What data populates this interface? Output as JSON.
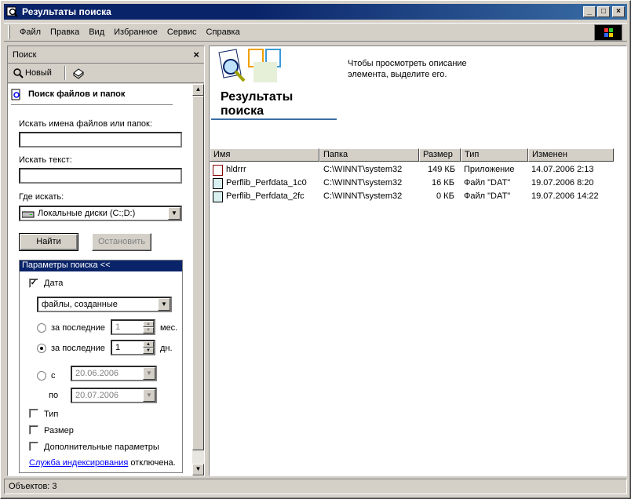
{
  "window": {
    "title": "Результаты поиска"
  },
  "menu": [
    "Файл",
    "Правка",
    "Вид",
    "Избранное",
    "Сервис",
    "Справка"
  ],
  "search_pane": {
    "header": "Поиск",
    "new_label": "Новый",
    "heading": "Поиск файлов и папок",
    "name_label": "Искать имена файлов или папок:",
    "name_value": "",
    "text_label": "Искать текст:",
    "text_value": "",
    "where_label": "Где искать:",
    "where_value": "Локальные диски (C:;D:)",
    "find_button": "Найти",
    "stop_button": "Остановить",
    "options_header": "Параметры поиска  <<",
    "date_label": "Дата",
    "date_checked": true,
    "date_mode": "файлы, созданные",
    "last_months_label": "за последние",
    "last_months_value": "1",
    "months_unit": "мес.",
    "last_days_label": "за последние",
    "last_days_value": "1",
    "days_unit": "дн.",
    "from_label": "с",
    "from_value": "20.06.2006",
    "to_label": "по",
    "to_value": "20.07.2006",
    "type_label": "Тип",
    "size_label": "Размер",
    "advanced_label": "Дополнительные параметры",
    "index_link": "Служба индексирования",
    "index_suffix": " отключена."
  },
  "results": {
    "title": "Результаты поиска",
    "hint": "Чтобы просмотреть описание элемента, выделите его.",
    "columns": [
      "Имя",
      "Папка",
      "Размер",
      "Тип",
      "Изменен"
    ],
    "rows": [
      {
        "name": "hldrrr",
        "folder": "C:\\WINNT\\system32",
        "size": "149 КБ",
        "type": "Приложение",
        "modified": "14.07.2006 2:13"
      },
      {
        "name": "Perflib_Perfdata_1c0",
        "folder": "C:\\WINNT\\system32",
        "size": "16 КБ",
        "type": "Файл \"DAT\"",
        "modified": "19.07.2006 8:20"
      },
      {
        "name": "Perflib_Perfdata_2fc",
        "folder": "C:\\WINNT\\system32",
        "size": "0 КБ",
        "type": "Файл \"DAT\"",
        "modified": "19.07.2006 14:22"
      }
    ]
  },
  "status": "Объектов: 3"
}
